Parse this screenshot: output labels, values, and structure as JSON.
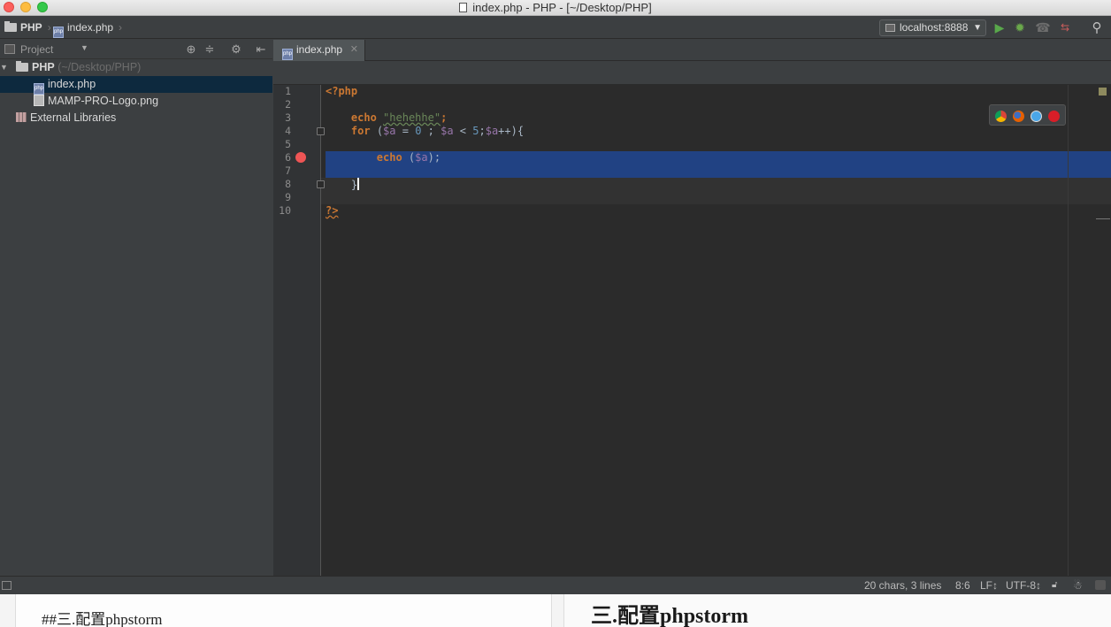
{
  "window": {
    "title": "index.php - PHP - [~/Desktop/PHP]"
  },
  "navbar": {
    "breadcrumbs": [
      "PHP",
      "index.php"
    ],
    "run_config": "localhost:8888"
  },
  "project_panel": {
    "title": "Project",
    "tree": [
      {
        "label": "PHP",
        "path": "(~/Desktop/PHP)"
      },
      {
        "label": "index.php"
      },
      {
        "label": "MAMP-PRO-Logo.png"
      },
      {
        "label": "External Libraries"
      }
    ]
  },
  "editor": {
    "tab": "index.php",
    "line_numbers": [
      "1",
      "2",
      "3",
      "4",
      "5",
      "6",
      "7",
      "8",
      "9",
      "10"
    ],
    "breakpoint_line": 6,
    "code": {
      "l1": "<?php",
      "l3_kw": "echo",
      "l3_str": "\"hehehhe\"",
      "l3_end": ";",
      "l4_kw": "for",
      "l4_a": " (",
      "l4_var1": "$a",
      "l4_b": " = ",
      "l4_num1": "0",
      "l4_c": " ; ",
      "l4_var2": "$a",
      "l4_d": " < ",
      "l4_num2": "5",
      "l4_e": ";",
      "l4_var3": "$a",
      "l4_f": "++){",
      "l6_kw": "echo",
      "l6_a": " (",
      "l6_var": "$a",
      "l6_b": ");",
      "l8": "}",
      "l10": "?>"
    },
    "browser_icons": [
      "chrome-icon",
      "firefox-icon",
      "safari-icon",
      "opera-icon"
    ]
  },
  "statusbar": {
    "selection": "20 chars, 3 lines",
    "position": "8:6",
    "line_sep": "LF↕",
    "encoding": "UTF-8↕"
  },
  "background_doc": {
    "left_text": "##三.配置phpstorm",
    "right_text": "三.配置phpstorm"
  }
}
